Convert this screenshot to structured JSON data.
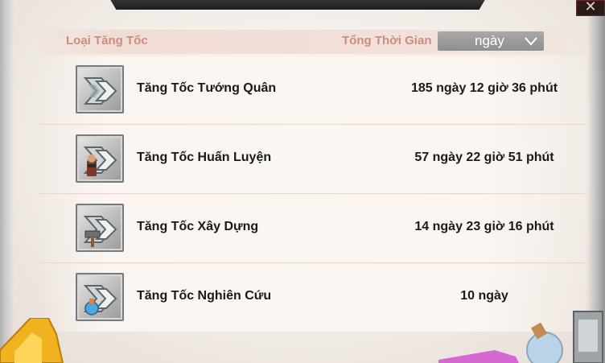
{
  "header": {
    "type_label": "Loại Tăng Tốc",
    "time_label": "Tổng Thời Gian",
    "unit_selected": "ngày"
  },
  "items": [
    {
      "name": "Tăng Tốc Tướng Quân",
      "time": "185 ngày 12 giờ 36 phút",
      "icon": "general-speedup-icon"
    },
    {
      "name": "Tăng Tốc Huấn Luyện",
      "time": "57 ngày 22 giờ 51 phút",
      "icon": "training-speedup-icon"
    },
    {
      "name": "Tăng Tốc Xây Dựng",
      "time": "14 ngày 23 giờ 16 phút",
      "icon": "building-speedup-icon"
    },
    {
      "name": "Tăng Tốc Nghiên Cứu",
      "time": "10 ngày",
      "icon": "research-speedup-icon"
    }
  ],
  "colors": {
    "header_text": "#c98e7e",
    "row_text": "#1a1a1a",
    "background": "#f5efea"
  }
}
